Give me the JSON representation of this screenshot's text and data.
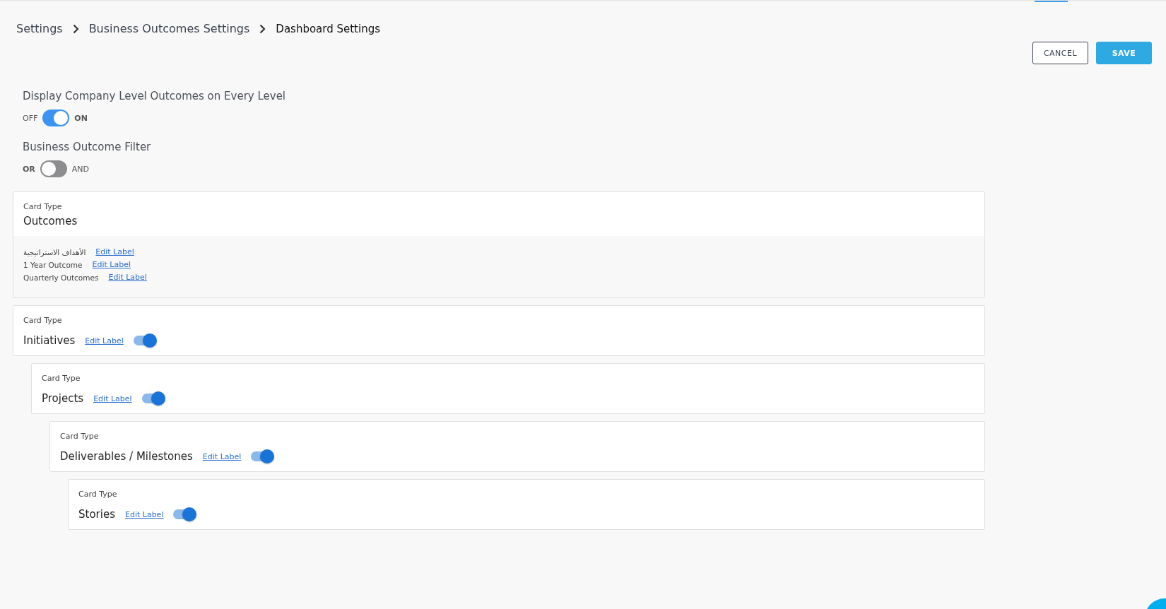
{
  "breadcrumb": [
    {
      "label": "Settings",
      "current": false
    },
    {
      "label": "Business Outcomes Settings",
      "current": false
    },
    {
      "label": "Dashboard Settings",
      "current": true
    }
  ],
  "actions": [
    {
      "label": "CANCEL",
      "kind": "secondary"
    },
    {
      "label": "SAVE",
      "kind": "primary"
    }
  ],
  "settings": [
    {
      "title": "Display Company Level Outcomes on Every Level",
      "off_label": "OFF",
      "on_label": "ON",
      "on": true
    },
    {
      "title": "Business Outcome Filter",
      "off_label": "OR",
      "on_label": "AND",
      "on": false
    }
  ],
  "cards": [
    {
      "kind": "levels",
      "caption": "Card Type",
      "title": "Outcomes",
      "levels": [
        {
          "name": "الأهداف الاستراتيجية",
          "link": "Edit Label"
        },
        {
          "name": "1 Year Outcome",
          "link": "Edit Label"
        },
        {
          "name": "Quarterly Outcomes",
          "link": "Edit Label"
        }
      ]
    },
    {
      "kind": "toggle",
      "caption": "Card Type",
      "title": "Initiatives",
      "link": "Edit Label",
      "on": true,
      "children": [
        {
          "kind": "toggle",
          "caption": "Card Type",
          "title": "Projects",
          "link": "Edit Label",
          "on": true,
          "children": [
            {
              "kind": "toggle",
              "caption": "Card Type",
              "title": "Deliverables / Milestones",
              "link": "Edit Label",
              "on": true,
              "children": [
                {
                  "kind": "toggle",
                  "caption": "Card Type",
                  "title": "Stories",
                  "link": "Edit Label",
                  "on": true
                }
              ]
            }
          ]
        }
      ]
    }
  ]
}
